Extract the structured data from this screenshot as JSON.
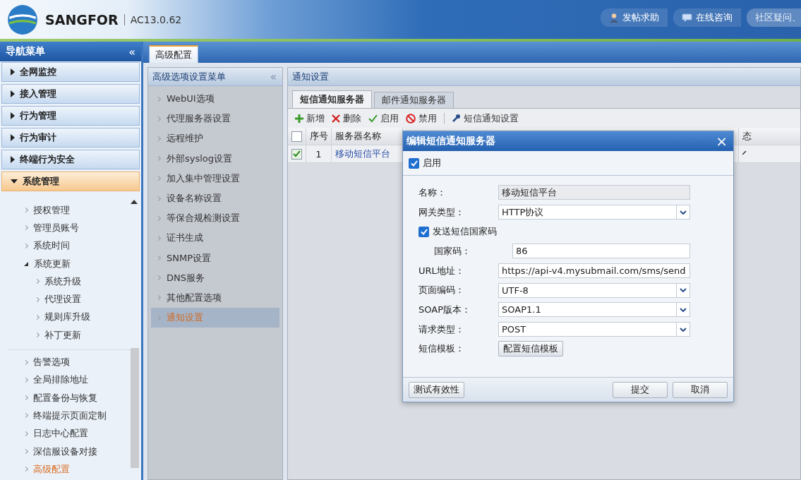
{
  "header": {
    "brand": "SANGFOR",
    "version": "AC13.0.62",
    "links": [
      {
        "label": "发帖求助",
        "kind": "person"
      },
      {
        "label": "在线咨询",
        "kind": "chat"
      },
      {
        "label": "社区疑问、",
        "kind": "search"
      }
    ]
  },
  "nav": {
    "title": "导航菜单",
    "collapse": "«",
    "groups": [
      {
        "label": "全网监控",
        "expanded": false
      },
      {
        "label": "接入管理",
        "expanded": false
      },
      {
        "label": "行为管理",
        "expanded": false
      },
      {
        "label": "行为审计",
        "expanded": false
      },
      {
        "label": "终端行为安全",
        "expanded": false
      },
      {
        "label": "系统管理",
        "expanded": true
      }
    ],
    "sections": [
      {
        "items": [
          {
            "label": "授权管理",
            "selected": false
          },
          {
            "label": "管理员账号",
            "selected": false
          },
          {
            "label": "系统时间",
            "selected": false
          },
          {
            "label": "系统更新",
            "selected": false,
            "expanded": true,
            "children": [
              {
                "label": "系统升级",
                "selected": false
              },
              {
                "label": "代理设置",
                "selected": false
              },
              {
                "label": "规则库升级",
                "selected": false
              },
              {
                "label": "补丁更新",
                "selected": false
              }
            ]
          }
        ]
      },
      {
        "items": [
          {
            "label": "告警选项",
            "selected": false
          },
          {
            "label": "全局排除地址",
            "selected": false
          },
          {
            "label": "配置备份与恢复",
            "selected": false
          },
          {
            "label": "终端提示页面定制",
            "selected": false
          },
          {
            "label": "日志中心配置",
            "selected": false
          },
          {
            "label": "深信服设备对接",
            "selected": false
          },
          {
            "label": "高级配置",
            "selected": true
          }
        ]
      }
    ]
  },
  "tabs": [
    {
      "label": "高级配置",
      "selected": true
    }
  ],
  "submenu": {
    "title": "高级选项设置菜单",
    "collapse": "«",
    "items": [
      {
        "label": "WebUI选项",
        "selected": false
      },
      {
        "label": "代理服务器设置",
        "selected": false
      },
      {
        "label": "远程维护",
        "selected": false
      },
      {
        "label": "外部syslog设置",
        "selected": false
      },
      {
        "label": "加入集中管理设置",
        "selected": false
      },
      {
        "label": "设备名称设置",
        "selected": false
      },
      {
        "label": "等保合规检测设置",
        "selected": false
      },
      {
        "label": "证书生成",
        "selected": false
      },
      {
        "label": "SNMP设置",
        "selected": false
      },
      {
        "label": "DNS服务",
        "selected": false
      },
      {
        "label": "其他配置选项",
        "selected": false
      },
      {
        "label": "通知设置",
        "selected": true
      }
    ]
  },
  "panel": {
    "title": "通知设置",
    "tabs": [
      {
        "label": "短信通知服务器",
        "selected": true
      },
      {
        "label": "邮件通知服务器",
        "selected": false
      }
    ],
    "toolbar": [
      {
        "label": "新增",
        "kind": "add"
      },
      {
        "label": "删除",
        "kind": "delete"
      },
      {
        "label": "启用",
        "kind": "enable"
      },
      {
        "label": "禁用",
        "kind": "disable"
      },
      {
        "label": "短信通知设置",
        "kind": "settings"
      }
    ],
    "table": {
      "header_checked": false,
      "columns": [
        "序号",
        "服务器名称",
        "态"
      ],
      "rows": [
        {
          "checked": true,
          "number": "1",
          "name": "移动短信平台",
          "enabled": true
        }
      ]
    }
  },
  "dialog": {
    "title": "编辑短信通知服务器",
    "close": "×",
    "enable": {
      "label": "启用",
      "checked": true
    },
    "fields": [
      {
        "kind": "text",
        "label": "名称：",
        "value": "移动短信平台",
        "disabled": true
      },
      {
        "kind": "select",
        "label": "网关类型：",
        "value": "HTTP协议"
      },
      {
        "kind": "checkbox",
        "label": "发送短信国家码",
        "checked": true
      },
      {
        "kind": "subtext",
        "label": "国家码：",
        "value": "86"
      },
      {
        "kind": "text",
        "label": "URL地址：",
        "value": "https://api-v4.mysubmail.com/sms/send",
        "disabled": false
      },
      {
        "kind": "select",
        "label": "页面编码：",
        "value": "UTF-8"
      },
      {
        "kind": "select",
        "label": "SOAP版本：",
        "value": "SOAP1.1"
      },
      {
        "kind": "select",
        "label": "请求类型：",
        "value": "POST"
      },
      {
        "kind": "button",
        "label": "短信模板：",
        "value": "配置短信模板"
      }
    ],
    "test_button": "测试有效性",
    "buttons": [
      "提交",
      "取消"
    ]
  }
}
